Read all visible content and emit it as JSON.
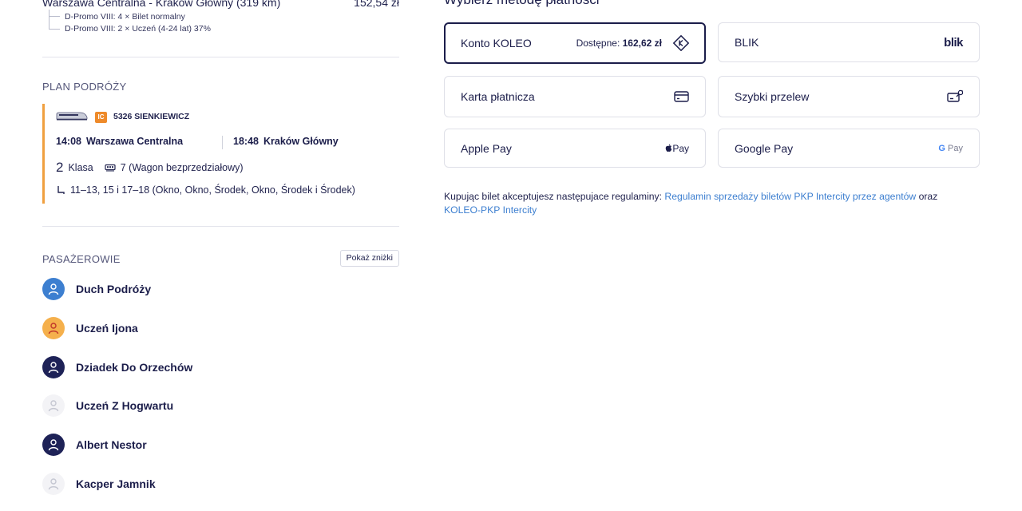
{
  "summary": {
    "route": "Warszawa Centralna - Kraków Główny (319 km)",
    "price": "152,54 zł",
    "fares": [
      "D-Promo VIII: 4 × Bilet normalny",
      "D-Promo VIII: 2 × Uczeń (4-24 lat) 37%"
    ]
  },
  "plan": {
    "title": "PLAN PODRÓŻY",
    "carrier_badge": "IC",
    "train_name": "5326 SIENKIEWICZ",
    "departure_time": "14:08",
    "departure_station": "Warszawa Centralna",
    "arrival_time": "18:48",
    "arrival_station": "Kraków Główny",
    "class_number": "2",
    "class_label": "Klasa",
    "wagon": "7 (Wagon bezprzedziałowy)",
    "seats": "11–13, 15 i 17–18 (Okno, Okno, Środek, Okno, Środek i Środek)"
  },
  "passengers": {
    "title": "PASAŻEROWIE",
    "show_discounts": "Pokaż zniżki",
    "list": [
      {
        "name": "Duch Podróży",
        "color": "#3d7fd0"
      },
      {
        "name": "Uczeń Ijona",
        "color": "#f5b04c"
      },
      {
        "name": "Dziadek Do Orzechów",
        "color": "#1e2257"
      },
      {
        "name": "Uczeń Z Hogwartu",
        "color": "#f3f3f6"
      },
      {
        "name": "Albert Nestor",
        "color": "#1e2257"
      },
      {
        "name": "Kacper Jamnik",
        "color": "#f3f3f6"
      }
    ]
  },
  "payment": {
    "title": "Wybierz metodę płatności",
    "koleo_label": "Konto KOLEO",
    "koleo_available_label": "Dostępne:",
    "koleo_available_value": "162,62 zł",
    "blik_label": "BLIK",
    "blik_logo": "blik",
    "card_label": "Karta płatnicza",
    "transfer_label": "Szybki przelew",
    "apple_label": "Apple Pay",
    "apple_logo": "Pay",
    "google_label": "Google Pay",
    "google_logo_g": "G",
    "google_logo_pay": "Pay"
  },
  "terms": {
    "text": "Kupując bilet akceptujesz następujace regulaminy: ",
    "link1": "Regulamin sprzedaży biletów PKP Intercity przez agentów",
    "and": " oraz ",
    "link2": "KOLEO-PKP Intercity"
  },
  "colors": {
    "accent": "#1b1d4a",
    "link": "#3d7fd0",
    "plan_bar": "#f0a040",
    "ic_badge": "#ee8a2a"
  }
}
